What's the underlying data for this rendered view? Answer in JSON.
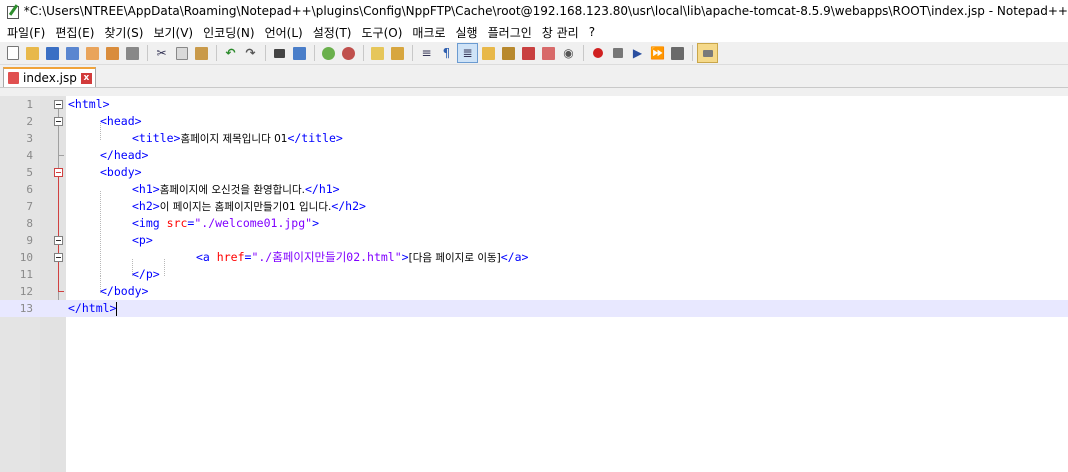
{
  "window": {
    "title": "*C:\\Users\\NTREE\\AppData\\Roaming\\Notepad++\\plugins\\Config\\NppFTP\\Cache\\root@192.168.123.80\\usr\\local\\lib\\apache-tomcat-8.5.9\\webapps\\ROOT\\index.jsp - Notepad++"
  },
  "menu": {
    "items": [
      "파일(F)",
      "편집(E)",
      "찾기(S)",
      "보기(V)",
      "인코딩(N)",
      "언어(L)",
      "설정(T)",
      "도구(O)",
      "매크로",
      "실행",
      "플러그인",
      "창 관리",
      "?"
    ]
  },
  "toolbar": {
    "icons": [
      "new-file-icon",
      "open-file-icon",
      "save-icon",
      "save-all-icon",
      "close-icon",
      "close-all-icon",
      "print-icon",
      "cut-icon",
      "copy-icon",
      "paste-icon",
      "undo-icon",
      "redo-icon",
      "find-icon",
      "replace-icon",
      "zoom-in-icon",
      "zoom-out-icon",
      "sync-vertical-icon",
      "sync-horizontal-icon",
      "word-wrap-icon",
      "show-all-chars-icon",
      "indent-guide-icon",
      "udl-icon",
      "document-map-icon",
      "function-list-icon",
      "folder-workspace-icon",
      "monitoring-icon",
      "record-macro-icon",
      "stop-record-icon",
      "play-macro-icon",
      "run-macro-multiple-icon",
      "save-macro-icon",
      "ftp-panel-icon"
    ]
  },
  "tabs": [
    {
      "label": "index.jsp",
      "modified": true
    }
  ],
  "editor": {
    "current_line": 13,
    "lines": [
      {
        "n": "1",
        "text": ""
      },
      {
        "n": "2",
        "text": ""
      },
      {
        "n": "3",
        "text": ""
      },
      {
        "n": "4",
        "text": ""
      },
      {
        "n": "5",
        "text": ""
      },
      {
        "n": "6",
        "text": ""
      },
      {
        "n": "7",
        "text": ""
      },
      {
        "n": "8",
        "text": ""
      },
      {
        "n": "9",
        "text": ""
      },
      {
        "n": "10",
        "text": ""
      },
      {
        "n": "11",
        "text": ""
      },
      {
        "n": "12",
        "text": ""
      },
      {
        "n": "13",
        "text": ""
      }
    ],
    "code": {
      "l1_tag": "<html>",
      "l2_tag": "<head>",
      "l3_open": "<title>",
      "l3_text": "홈페이지 제목입니다 01",
      "l3_close": "</title>",
      "l4_tag": "</head>",
      "l5_tag": "<body>",
      "l6_open": "<h1>",
      "l6_text": "홈페이지에 오신것을 환영합니다.",
      "l6_close": "</h1>",
      "l7_open": "<h2>",
      "l7_text": "이 페이지는 홈페이지만들기01 입니다.",
      "l7_close": "</h2>",
      "l8_tag": "<img",
      "l8_attr": "src",
      "l8_eq": "=",
      "l8_val": "\"./welcome01.jpg\"",
      "l8_end": ">",
      "l9_tag": "<p>",
      "l10_tag": "<a",
      "l10_attr": "href",
      "l10_eq": "=",
      "l10_val": "\"./홈페이지만들기02.html\"",
      "l10_end": ">",
      "l10_text": "[다음 페이지로 이동]",
      "l10_close": "</a>",
      "l11_tag": "</p>",
      "l12_tag": "</body>",
      "l13_tag": "</html>"
    }
  },
  "colors": {
    "tag": "#0000ff",
    "attribute": "#ff0000",
    "string": "#8000ff",
    "current_line": "#e8e8ff",
    "tab_accent": "#f0a33a"
  }
}
